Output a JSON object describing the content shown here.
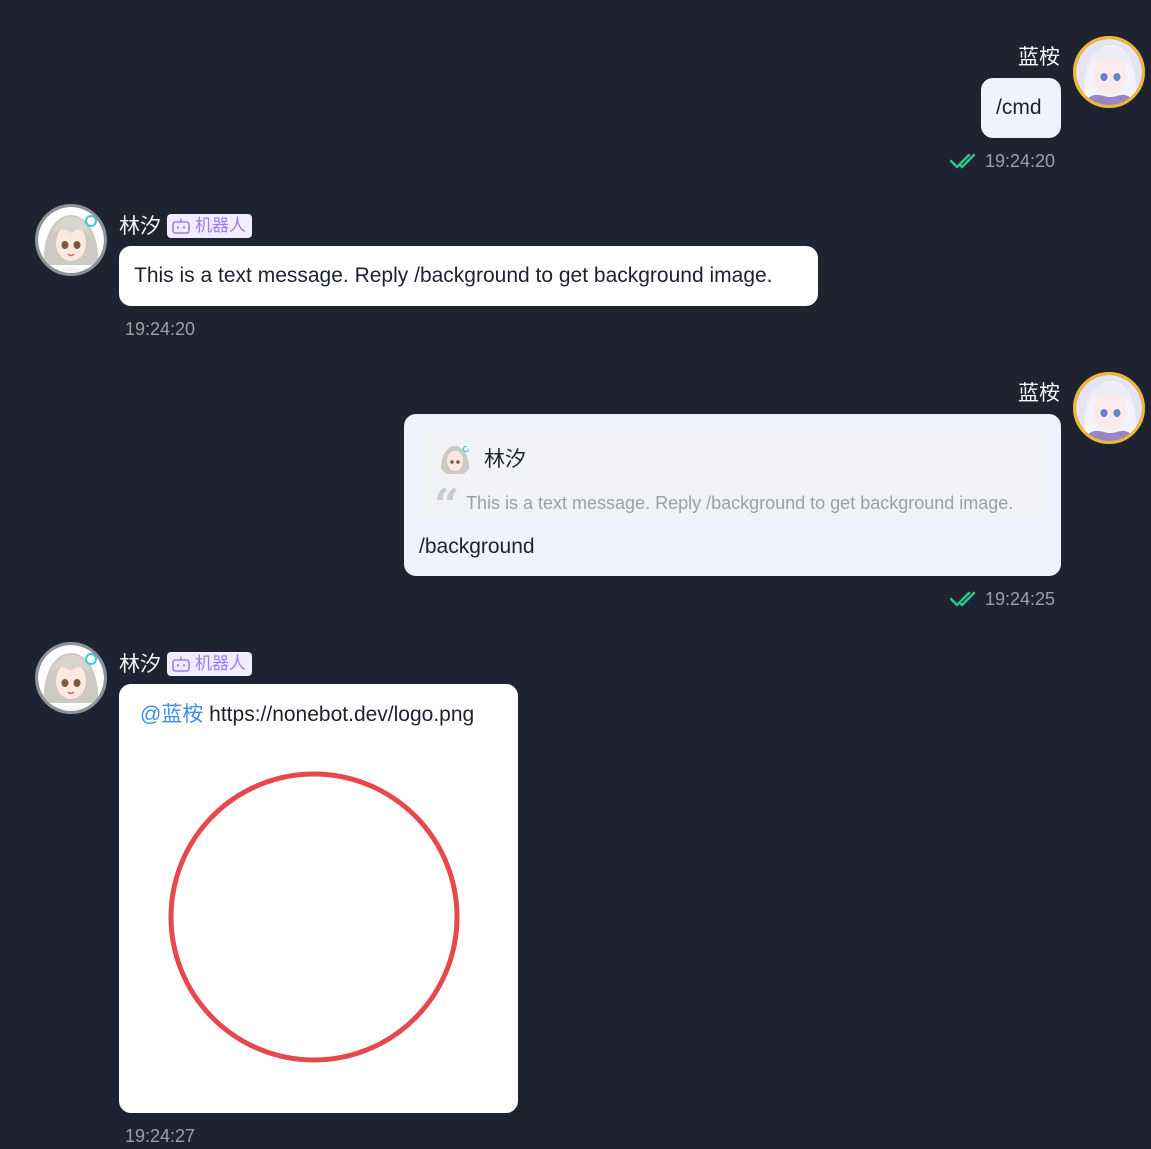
{
  "user": {
    "name": "蓝桉"
  },
  "bot": {
    "name": "林汐",
    "badge": "机器人"
  },
  "messages": [
    {
      "text": "/cmd",
      "time": "19:24:20"
    },
    {
      "text": "This is a text message. Reply /background to get background image.",
      "time": "19:24:20"
    },
    {
      "quote": {
        "name": "林汐",
        "text": "This is a text message. Reply /background to get background image."
      },
      "text": "/background",
      "time": "19:24:25"
    },
    {
      "mention": "@蓝桉",
      "text": "https://nonebot.dev/logo.png",
      "time": "19:24:27",
      "image": "red-circle-logo"
    }
  ],
  "colors": {
    "background": "#1f2230",
    "outgoing_bubble": "#eef3fd",
    "incoming_bubble": "#ffffff",
    "read_check": "#2fc28a",
    "mention": "#3d8ee6",
    "badge_text": "#9b7ff0",
    "user_avatar_ring": "#f2b82e",
    "logo_circle": "#e5484d"
  }
}
